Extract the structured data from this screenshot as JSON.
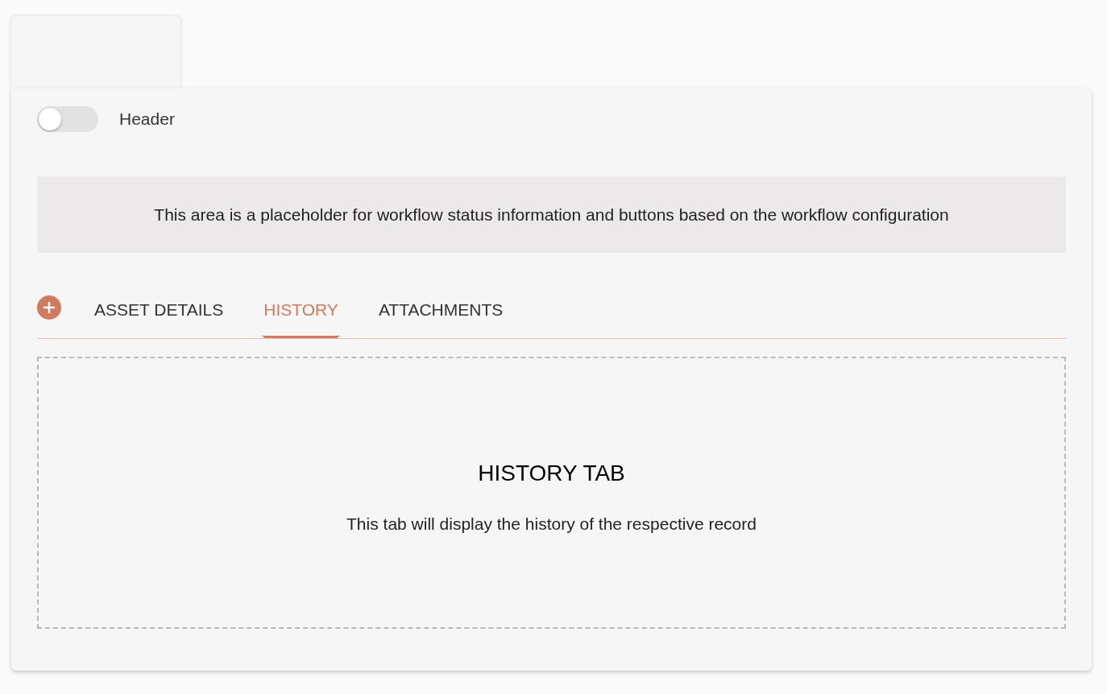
{
  "header_toggle": {
    "label": "Header",
    "on": false
  },
  "workflow_placeholder": "This area is a placeholder for workflow status information and buttons based on the workflow configuration",
  "tabs": [
    {
      "label": "ASSET DETAILS",
      "selected": false
    },
    {
      "label": "HISTORY",
      "selected": true
    },
    {
      "label": "ATTACHMENTS",
      "selected": false
    }
  ],
  "tab_content": {
    "title": "HISTORY TAB",
    "description": "This tab will display the history of the respective record"
  }
}
